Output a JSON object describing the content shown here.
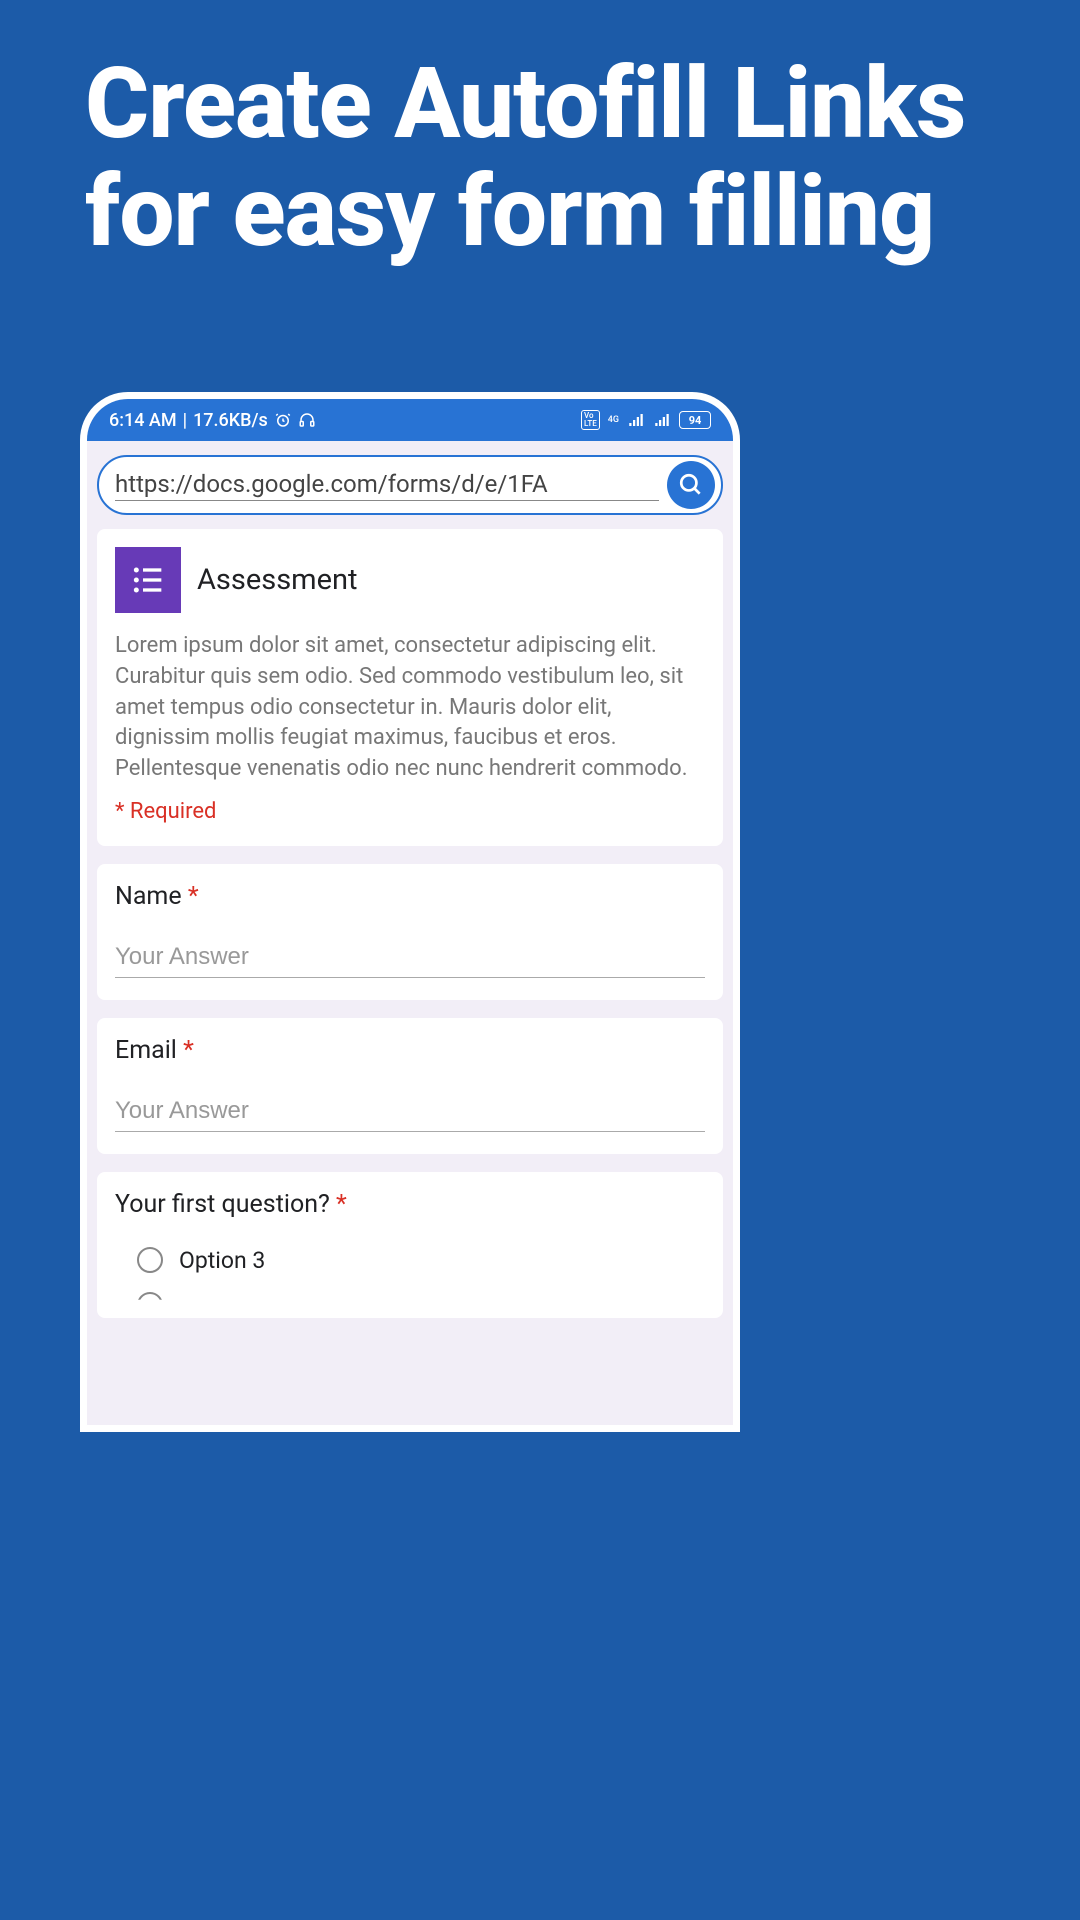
{
  "headline": "Create Autofill Links for easy form filling",
  "status_bar": {
    "time": "6:14 AM",
    "speed": "17.6KB/s",
    "network_label": "4G",
    "volte_label": "Vo LTE",
    "battery": "94"
  },
  "url_bar": {
    "url": "https://docs.google.com/forms/d/e/1FA"
  },
  "form": {
    "title": "Assessment",
    "description": "Lorem ipsum dolor sit amet, consectetur adipiscing elit. Curabitur quis sem odio. Sed commodo vestibulum leo, sit amet tempus odio consectetur in. Mauris dolor elit, dignissim mollis feugiat maximus, faucibus et eros. Pellentesque venenatis odio nec nunc hendrerit commodo.",
    "required_note": "* Required",
    "questions": [
      {
        "label": "Name",
        "required": true,
        "placeholder": "Your Answer",
        "type": "text"
      },
      {
        "label": "Email",
        "required": true,
        "placeholder": "Your Answer",
        "type": "text"
      },
      {
        "label": "Your first question?",
        "required": true,
        "type": "radio",
        "options": [
          "Option 3"
        ]
      }
    ]
  }
}
